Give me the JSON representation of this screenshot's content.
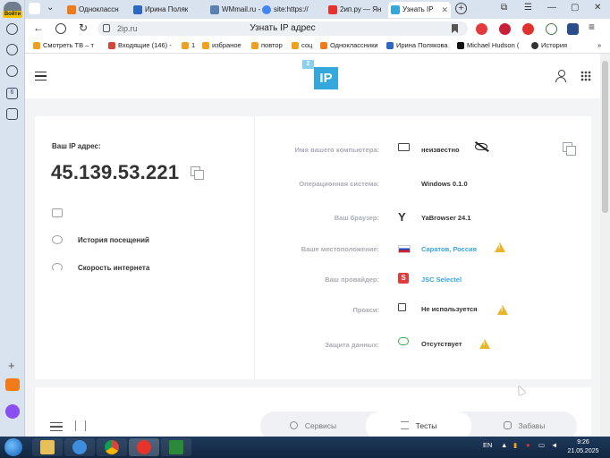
{
  "sidebar": {
    "login_label": "Войти"
  },
  "tabs": [
    {
      "label": "Одноклассн",
      "color": "#f07b1b"
    },
    {
      "label": "Ирина Поляк",
      "color": "#2f68c0"
    },
    {
      "label": "WMmail.ru -",
      "color": "#5a7fb0"
    },
    {
      "label": "site:https://",
      "color": "#4285f4"
    },
    {
      "label": "2ип.ру — Ян",
      "color": "#e8322c"
    },
    {
      "label": "Узнать IP",
      "color": "#34a8dc",
      "active": true
    }
  ],
  "address": {
    "url": "2ip.ru",
    "page_title": "Узнать IP адрес"
  },
  "bookmarks": [
    {
      "label": "Смотреть ТВ – т",
      "color": "#f0a020"
    },
    {
      "label": "Входящие (146) -",
      "color": "#d44638"
    },
    {
      "label": "1",
      "color": "#f0a020"
    },
    {
      "label": "избраное",
      "color": "#f0a020"
    },
    {
      "label": "повтор",
      "color": "#f0a020"
    },
    {
      "label": "соц",
      "color": "#f0a020"
    },
    {
      "label": "Одноклассники",
      "color": "#f07b1b"
    },
    {
      "label": "Ирина Полякова",
      "color": "#2f68c0"
    },
    {
      "label": "Michael Hudson (",
      "color": "#111111"
    },
    {
      "label": "История",
      "color": "#333333"
    }
  ],
  "site": {
    "logo_text": "IP",
    "logo_sup": "2"
  },
  "ip_panel": {
    "label": "Ваш IP адрес:",
    "value": "45.139.53.221",
    "links": [
      {
        "label": "История посещений"
      },
      {
        "label": "Скорость интернета"
      }
    ]
  },
  "info_rows": [
    {
      "label": "Имя вашего компьютера:",
      "value": "неизвестно",
      "icon": "monitor-icon"
    },
    {
      "label": "Операционная система:",
      "value": "Windows 0.1.0",
      "icon": "none"
    },
    {
      "label": "Ваш браузер:",
      "value": "YaBrowser 24.1",
      "icon": "yandex-browser-icon"
    },
    {
      "label": "Ваше местоположение:",
      "value": "Саратов, Россия",
      "icon": "russia-flag-icon",
      "link": true,
      "warning": true
    },
    {
      "label": "Ваш провайдер:",
      "value": "JSC Selectel",
      "icon": "selectel-logo-icon",
      "link": true
    },
    {
      "label": "Прокси:",
      "value": "Не используется",
      "icon": "network-icon",
      "warning": true
    },
    {
      "label": "Защита данных:",
      "value": "Отсутствует",
      "icon": "cloud-lock-icon",
      "warning": true
    }
  ],
  "bottom_tabs": [
    {
      "label": "Сервисы"
    },
    {
      "label": "Тесты",
      "active": true
    },
    {
      "label": "Забавы"
    }
  ],
  "taskbar": {
    "lang": "EN",
    "time": "9:26",
    "date": "21.05.2025"
  }
}
